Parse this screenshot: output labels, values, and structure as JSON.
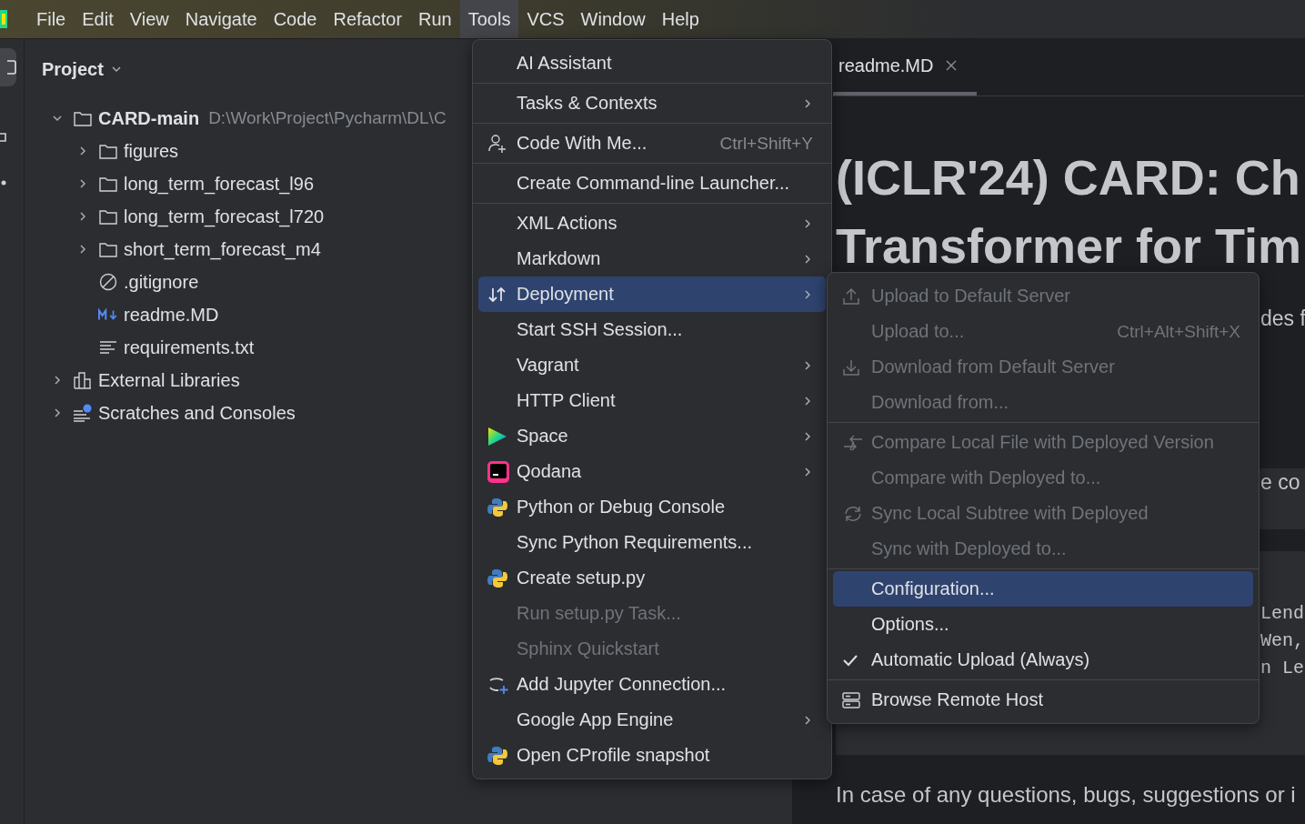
{
  "menu_bar": [
    {
      "label": "File",
      "selected": false
    },
    {
      "label": "Edit",
      "selected": false
    },
    {
      "label": "View",
      "selected": false
    },
    {
      "label": "Navigate",
      "selected": false
    },
    {
      "label": "Code",
      "selected": false
    },
    {
      "label": "Refactor",
      "selected": false
    },
    {
      "label": "Run",
      "selected": false
    },
    {
      "label": "Tools",
      "selected": true
    },
    {
      "label": "VCS",
      "selected": false
    },
    {
      "label": "Window",
      "selected": false
    },
    {
      "label": "Help",
      "selected": false
    }
  ],
  "project_panel": {
    "title": "Project",
    "tree": [
      {
        "label": "CARD-main",
        "path": "D:\\Work\\Project\\Pycharm\\DL\\C",
        "kind": "folder",
        "expanded": true,
        "children": [
          {
            "label": "figures",
            "kind": "folder",
            "expanded": false
          },
          {
            "label": "long_term_forecast_l96",
            "kind": "folder",
            "expanded": false
          },
          {
            "label": "long_term_forecast_l720",
            "kind": "folder",
            "expanded": false
          },
          {
            "label": "short_term_forecast_m4",
            "kind": "folder",
            "expanded": false
          },
          {
            "label": ".gitignore",
            "kind": "ignore"
          },
          {
            "label": "readme.MD",
            "kind": "markdown"
          },
          {
            "label": "requirements.txt",
            "kind": "text"
          }
        ]
      },
      {
        "label": "External Libraries",
        "kind": "library",
        "expanded": false
      },
      {
        "label": "Scratches and Consoles",
        "kind": "scratches",
        "expanded": false
      }
    ]
  },
  "editor": {
    "tabs": [
      {
        "label": "readme.MD",
        "selected": true
      }
    ],
    "title_lines": [
      "(ICLR'24) CARD: Ch",
      "Transformer for Tim"
    ],
    "paragraph_fragment": "des f",
    "quote_fragment": "e co",
    "code_fragments": [
      "Lend",
      "Wen,",
      "n Le"
    ],
    "footer_text": "In case of any questions, bugs, suggestions or i"
  },
  "tools_menu": {
    "groups": [
      {
        "items": [
          {
            "label": "AI Assistant",
            "has_submenu": false,
            "disabled": false,
            "selected": false
          }
        ]
      },
      {
        "items": [
          {
            "label": "Tasks & Contexts",
            "has_submenu": true,
            "disabled": false,
            "selected": false
          }
        ]
      },
      {
        "items": [
          {
            "label": "Code With Me...",
            "shortcut": "Ctrl+Shift+Y",
            "has_submenu": false,
            "disabled": false,
            "selected": false
          }
        ]
      },
      {
        "items": [
          {
            "label": "Create Command-line Launcher...",
            "has_submenu": false,
            "disabled": false,
            "selected": false
          }
        ]
      },
      {
        "items": [
          {
            "label": "XML Actions",
            "has_submenu": true,
            "disabled": false,
            "selected": false
          },
          {
            "label": "Markdown",
            "has_submenu": true,
            "disabled": false,
            "selected": false
          },
          {
            "label": "Deployment",
            "has_submenu": true,
            "disabled": false,
            "selected": true
          },
          {
            "label": "Start SSH Session...",
            "has_submenu": false,
            "disabled": false,
            "selected": false
          },
          {
            "label": "Vagrant",
            "has_submenu": true,
            "disabled": false,
            "selected": false
          },
          {
            "label": "HTTP Client",
            "has_submenu": true,
            "disabled": false,
            "selected": false
          },
          {
            "label": "Space",
            "has_submenu": true,
            "disabled": false,
            "selected": false
          },
          {
            "label": "Qodana",
            "has_submenu": true,
            "disabled": false,
            "selected": false
          },
          {
            "label": "Python or Debug Console",
            "has_submenu": false,
            "disabled": false,
            "selected": false
          },
          {
            "label": "Sync Python Requirements...",
            "has_submenu": false,
            "disabled": false,
            "selected": false
          },
          {
            "label": "Create setup.py",
            "has_submenu": false,
            "disabled": false,
            "selected": false
          },
          {
            "label": "Run setup.py Task...",
            "has_submenu": false,
            "disabled": true,
            "selected": false
          },
          {
            "label": "Sphinx Quickstart",
            "has_submenu": false,
            "disabled": true,
            "selected": false
          },
          {
            "label": "Add Jupyter Connection...",
            "has_submenu": false,
            "disabled": false,
            "selected": false
          },
          {
            "label": "Google App Engine",
            "has_submenu": true,
            "disabled": false,
            "selected": false
          },
          {
            "label": "Open CProfile snapshot",
            "has_submenu": false,
            "disabled": false,
            "selected": false
          }
        ]
      }
    ]
  },
  "deployment_submenu": {
    "groups": [
      {
        "items": [
          {
            "label": "Upload to Default Server",
            "disabled": true,
            "selected": false,
            "checked": false
          },
          {
            "label": "Upload to...",
            "shortcut": "Ctrl+Alt+Shift+X",
            "disabled": true,
            "selected": false,
            "checked": false
          },
          {
            "label": "Download from Default Server",
            "disabled": true,
            "selected": false,
            "checked": false
          },
          {
            "label": "Download from...",
            "disabled": true,
            "selected": false,
            "checked": false
          }
        ]
      },
      {
        "items": [
          {
            "label": "Compare Local File with Deployed Version",
            "disabled": true,
            "selected": false,
            "checked": false
          },
          {
            "label": "Compare with Deployed to...",
            "disabled": true,
            "selected": false,
            "checked": false
          },
          {
            "label": "Sync Local Subtree with Deployed",
            "disabled": true,
            "selected": false,
            "checked": false
          },
          {
            "label": "Sync with Deployed to...",
            "disabled": true,
            "selected": false,
            "checked": false
          }
        ]
      },
      {
        "items": [
          {
            "label": "Configuration...",
            "disabled": false,
            "selected": true,
            "checked": false
          },
          {
            "label": "Options...",
            "disabled": false,
            "selected": false,
            "checked": false
          },
          {
            "label": "Automatic Upload (Always)",
            "disabled": false,
            "selected": false,
            "checked": true
          }
        ]
      },
      {
        "items": [
          {
            "label": "Browse Remote Host",
            "disabled": false,
            "selected": false,
            "checked": false
          }
        ]
      }
    ]
  }
}
